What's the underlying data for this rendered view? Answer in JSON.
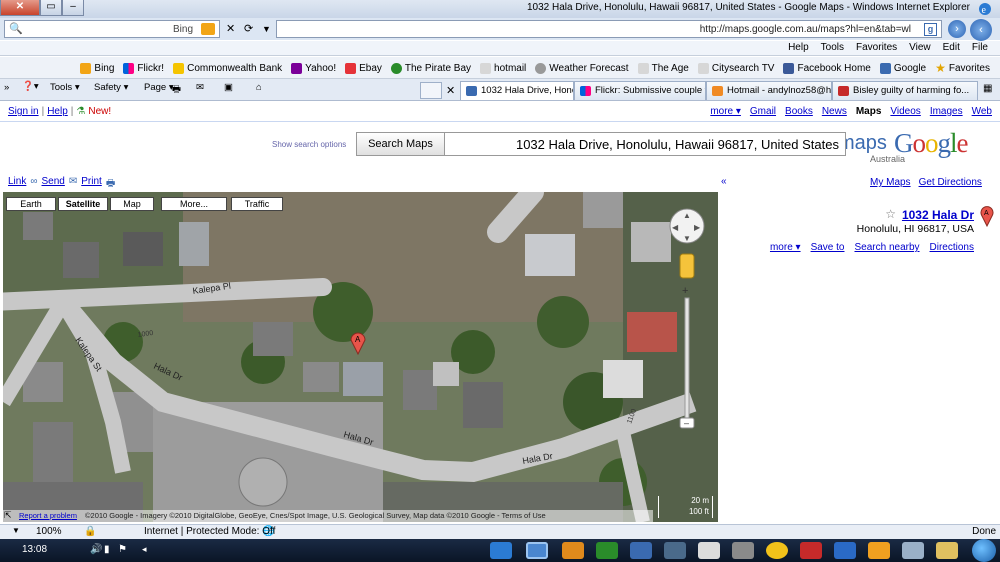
{
  "window": {
    "title": "1032 Hala Drive, Honolulu, Hawaii 96817, United States - Google Maps - Windows Internet Explorer",
    "close_label": "✕",
    "max_label": "▭",
    "min_label": "–"
  },
  "address_bar": {
    "search_placeholder": "Bing",
    "url": "http://maps.google.com.au/maps?hl=en&tab=wl",
    "search_icon": "🔍"
  },
  "menu": [
    "File",
    "Edit",
    "View",
    "Favorites",
    "Tools",
    "Help"
  ],
  "favorites": {
    "label": "Favorites",
    "items": [
      "Google",
      "Facebook Home",
      "Citysearch TV",
      "The Age",
      "Weather Forecast",
      "hotmail",
      "The Pirate Bay",
      "Ebay",
      "Yahoo!",
      "Commonwealth Bank",
      "Flickr!",
      "Bing"
    ]
  },
  "tabs": [
    {
      "label": "Bisley guilty of harming fo..."
    },
    {
      "label": "Hotmail - andylnoz58@ho..."
    },
    {
      "label": "Flickr: Submissive couple f..."
    },
    {
      "label": "1032 Hala Drive, Honol..."
    }
  ],
  "command_bar": [
    "Page ▾",
    "Safety ▾",
    "Tools ▾"
  ],
  "google_bar": {
    "left": [
      "Web",
      "Images",
      "Videos",
      "Maps",
      "News",
      "Books",
      "Gmail",
      "more ▾"
    ],
    "right": [
      "Sign in",
      "Help",
      "New!"
    ]
  },
  "logo": {
    "text": "Google",
    "product": "maps",
    "region": "Australia"
  },
  "search": {
    "query": "1032 Hala Drive, Honolulu, Hawaii 96817, United States",
    "button": "Search Maps",
    "options": "Show search options"
  },
  "map_tools": {
    "print": "Print",
    "send": "Send",
    "link": "Link"
  },
  "panel": {
    "get_directions": "Get Directions",
    "my_maps": "My Maps",
    "collapse": "«"
  },
  "result": {
    "name": "1032 Hala Dr",
    "address": "Honolulu, HI 96817, USA",
    "actions": [
      "Directions",
      "Search nearby",
      "Save to",
      "more ▾"
    ]
  },
  "map": {
    "types": [
      "Traffic",
      "More...",
      "Map",
      "Satellite",
      "Earth"
    ],
    "labels": {
      "kalepa_pl": "Kalepa Pl",
      "kalepa_st": "Kalepa St",
      "hala_dr_1": "Hala Dr",
      "hala_dr_2": "Hala Dr",
      "hala_dr_3": "Hala Dr",
      "num_1000": "1000",
      "num_1100": "1100"
    },
    "marker": "A",
    "scale": {
      "top": "20 m",
      "bottom": "100 ft"
    },
    "attribution": "©2010 Google - Imagery ©2010 DigitalGlobe, GeoEye, Cnes/Spot Image, U.S. Geological Survey, Map data ©2010 Google - Terms of Use",
    "report": "Report a problem"
  },
  "status": {
    "done": "Done",
    "zone": "Internet | Protected Mode: Off",
    "zoom": "100%"
  },
  "taskbar": {
    "clock": "13:08"
  },
  "colors": {
    "google_blue": "#3a6ab0",
    "link": "#0000cc",
    "map_road": "#c8c8c8"
  }
}
